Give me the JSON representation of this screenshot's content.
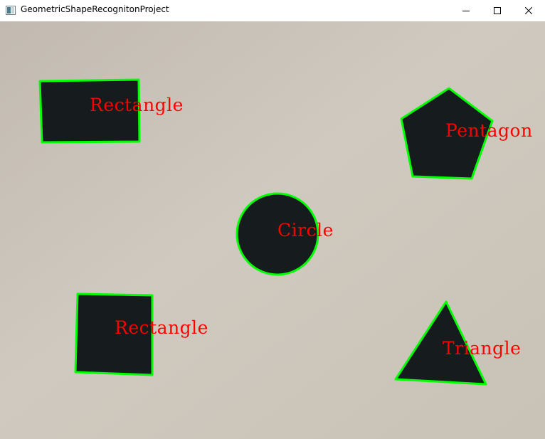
{
  "window": {
    "title": "GeometricShapeRecognitonProject",
    "icon": "opencv-window-icon",
    "controls": [
      "minimize-icon",
      "maximize-icon",
      "close-icon"
    ]
  },
  "image": {
    "colors": {
      "background_light": "#cfc9bf",
      "background_dark": "#c2bab0",
      "shape_fill": "#161b1e",
      "contour": "#00ff00",
      "label": "#ff0000"
    },
    "detections": [
      {
        "shape": "rectangle",
        "label": "Rectangle"
      },
      {
        "shape": "pentagon",
        "label": "Pentagon"
      },
      {
        "shape": "circle",
        "label": "Circle"
      },
      {
        "shape": "rectangle",
        "label": "Rectangle"
      },
      {
        "shape": "triangle",
        "label": "Triangle"
      }
    ]
  }
}
